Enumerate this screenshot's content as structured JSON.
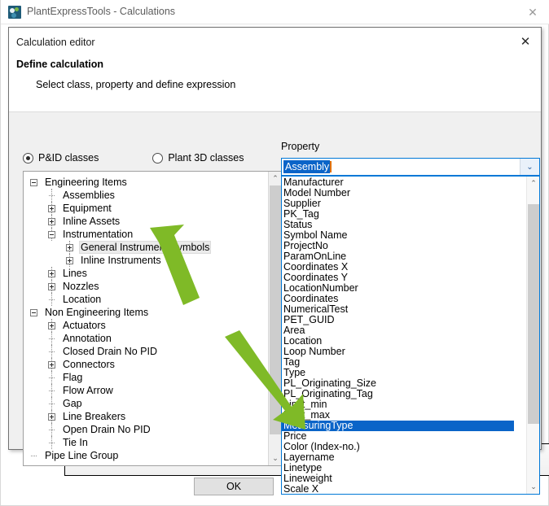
{
  "window": {
    "title": "PlantExpressTools - Calculations",
    "close_label": "✕",
    "icon": "app-logo-icon"
  },
  "dialog": {
    "title": "Calculation editor",
    "heading": "Define calculation",
    "subtitle": "Select class, property and define expression",
    "close_label": "✕",
    "ok_label": "OK"
  },
  "class_source": {
    "options": [
      {
        "label": "P&ID classes",
        "selected": true
      },
      {
        "label": "Plant 3D classes",
        "selected": false
      }
    ]
  },
  "tree": {
    "items": [
      {
        "label": "Engineering Items",
        "depth": 0,
        "expander": "minus",
        "selected": false
      },
      {
        "label": "Assemblies",
        "depth": 1,
        "expander": "none",
        "selected": false
      },
      {
        "label": "Equipment",
        "depth": 1,
        "expander": "plus",
        "selected": false
      },
      {
        "label": "Inline Assets",
        "depth": 1,
        "expander": "plus",
        "selected": false
      },
      {
        "label": "Instrumentation",
        "depth": 1,
        "expander": "minus",
        "selected": false
      },
      {
        "label": "General Instrument Symbols",
        "depth": 2,
        "expander": "plus",
        "selected": true
      },
      {
        "label": "Inline Instruments",
        "depth": 2,
        "expander": "plus",
        "selected": false
      },
      {
        "label": "Lines",
        "depth": 1,
        "expander": "plus",
        "selected": false
      },
      {
        "label": "Nozzles",
        "depth": 1,
        "expander": "plus",
        "selected": false
      },
      {
        "label": "Location",
        "depth": 1,
        "expander": "none",
        "selected": false
      },
      {
        "label": "Non Engineering Items",
        "depth": 0,
        "expander": "minus",
        "selected": false
      },
      {
        "label": "Actuators",
        "depth": 1,
        "expander": "plus",
        "selected": false
      },
      {
        "label": "Annotation",
        "depth": 1,
        "expander": "none",
        "selected": false
      },
      {
        "label": "Closed Drain No PID",
        "depth": 1,
        "expander": "none",
        "selected": false
      },
      {
        "label": "Connectors",
        "depth": 1,
        "expander": "plus",
        "selected": false
      },
      {
        "label": "Flag",
        "depth": 1,
        "expander": "none",
        "selected": false
      },
      {
        "label": "Flow Arrow",
        "depth": 1,
        "expander": "none",
        "selected": false
      },
      {
        "label": "Gap",
        "depth": 1,
        "expander": "none",
        "selected": false
      },
      {
        "label": "Line Breakers",
        "depth": 1,
        "expander": "plus",
        "selected": false
      },
      {
        "label": "Open Drain No PID",
        "depth": 1,
        "expander": "none",
        "selected": false
      },
      {
        "label": "Tie In",
        "depth": 1,
        "expander": "none",
        "selected": false
      },
      {
        "label": "Pipe Line Group",
        "depth": 0,
        "expander": "none",
        "selected": false
      }
    ],
    "scrollbar": {
      "up_arrow": "⌃",
      "down_arrow": "⌄"
    }
  },
  "property": {
    "label": "Property",
    "selected_value": "Assembly",
    "dropdown_caret": "⌄",
    "items": [
      {
        "label": "Manufacturer",
        "selected": false
      },
      {
        "label": "Model Number",
        "selected": false
      },
      {
        "label": "Supplier",
        "selected": false
      },
      {
        "label": "PK_Tag",
        "selected": false
      },
      {
        "label": "Status",
        "selected": false
      },
      {
        "label": "Symbol Name",
        "selected": false
      },
      {
        "label": "ProjectNo",
        "selected": false
      },
      {
        "label": "ParamOnLine",
        "selected": false
      },
      {
        "label": "Coordinates X",
        "selected": false
      },
      {
        "label": "Coordinates Y",
        "selected": false
      },
      {
        "label": "LocationNumber",
        "selected": false
      },
      {
        "label": "Coordinates",
        "selected": false
      },
      {
        "label": "NumericalTest",
        "selected": false
      },
      {
        "label": "PET_GUID",
        "selected": false
      },
      {
        "label": "Area",
        "selected": false
      },
      {
        "label": "Location",
        "selected": false
      },
      {
        "label": "Loop Number",
        "selected": false
      },
      {
        "label": "Tag",
        "selected": false
      },
      {
        "label": "Type",
        "selected": false
      },
      {
        "label": "PL_Originating_Size",
        "selected": false
      },
      {
        "label": "PL_Originating_Tag",
        "selected": false
      },
      {
        "label": "Limit_min",
        "selected": false
      },
      {
        "label": "Limit_max",
        "selected": false
      },
      {
        "label": "MeasuringType",
        "selected": true
      },
      {
        "label": "Price",
        "selected": false
      },
      {
        "label": "Color (Index-no.)",
        "selected": false
      },
      {
        "label": "Layername",
        "selected": false
      },
      {
        "label": "Linetype",
        "selected": false
      },
      {
        "label": "Lineweight",
        "selected": false
      },
      {
        "label": "Scale X",
        "selected": false
      }
    ],
    "scrollbar": {
      "up_arrow": "⌃",
      "down_arrow": "⌄"
    }
  },
  "annotations": {
    "arrow_color": "#7fba27",
    "arrows": [
      {
        "name": "arrow-to-general-instrument-symbols",
        "direction": "up-left"
      },
      {
        "name": "arrow-to-measuringtype",
        "direction": "down-right"
      }
    ]
  }
}
